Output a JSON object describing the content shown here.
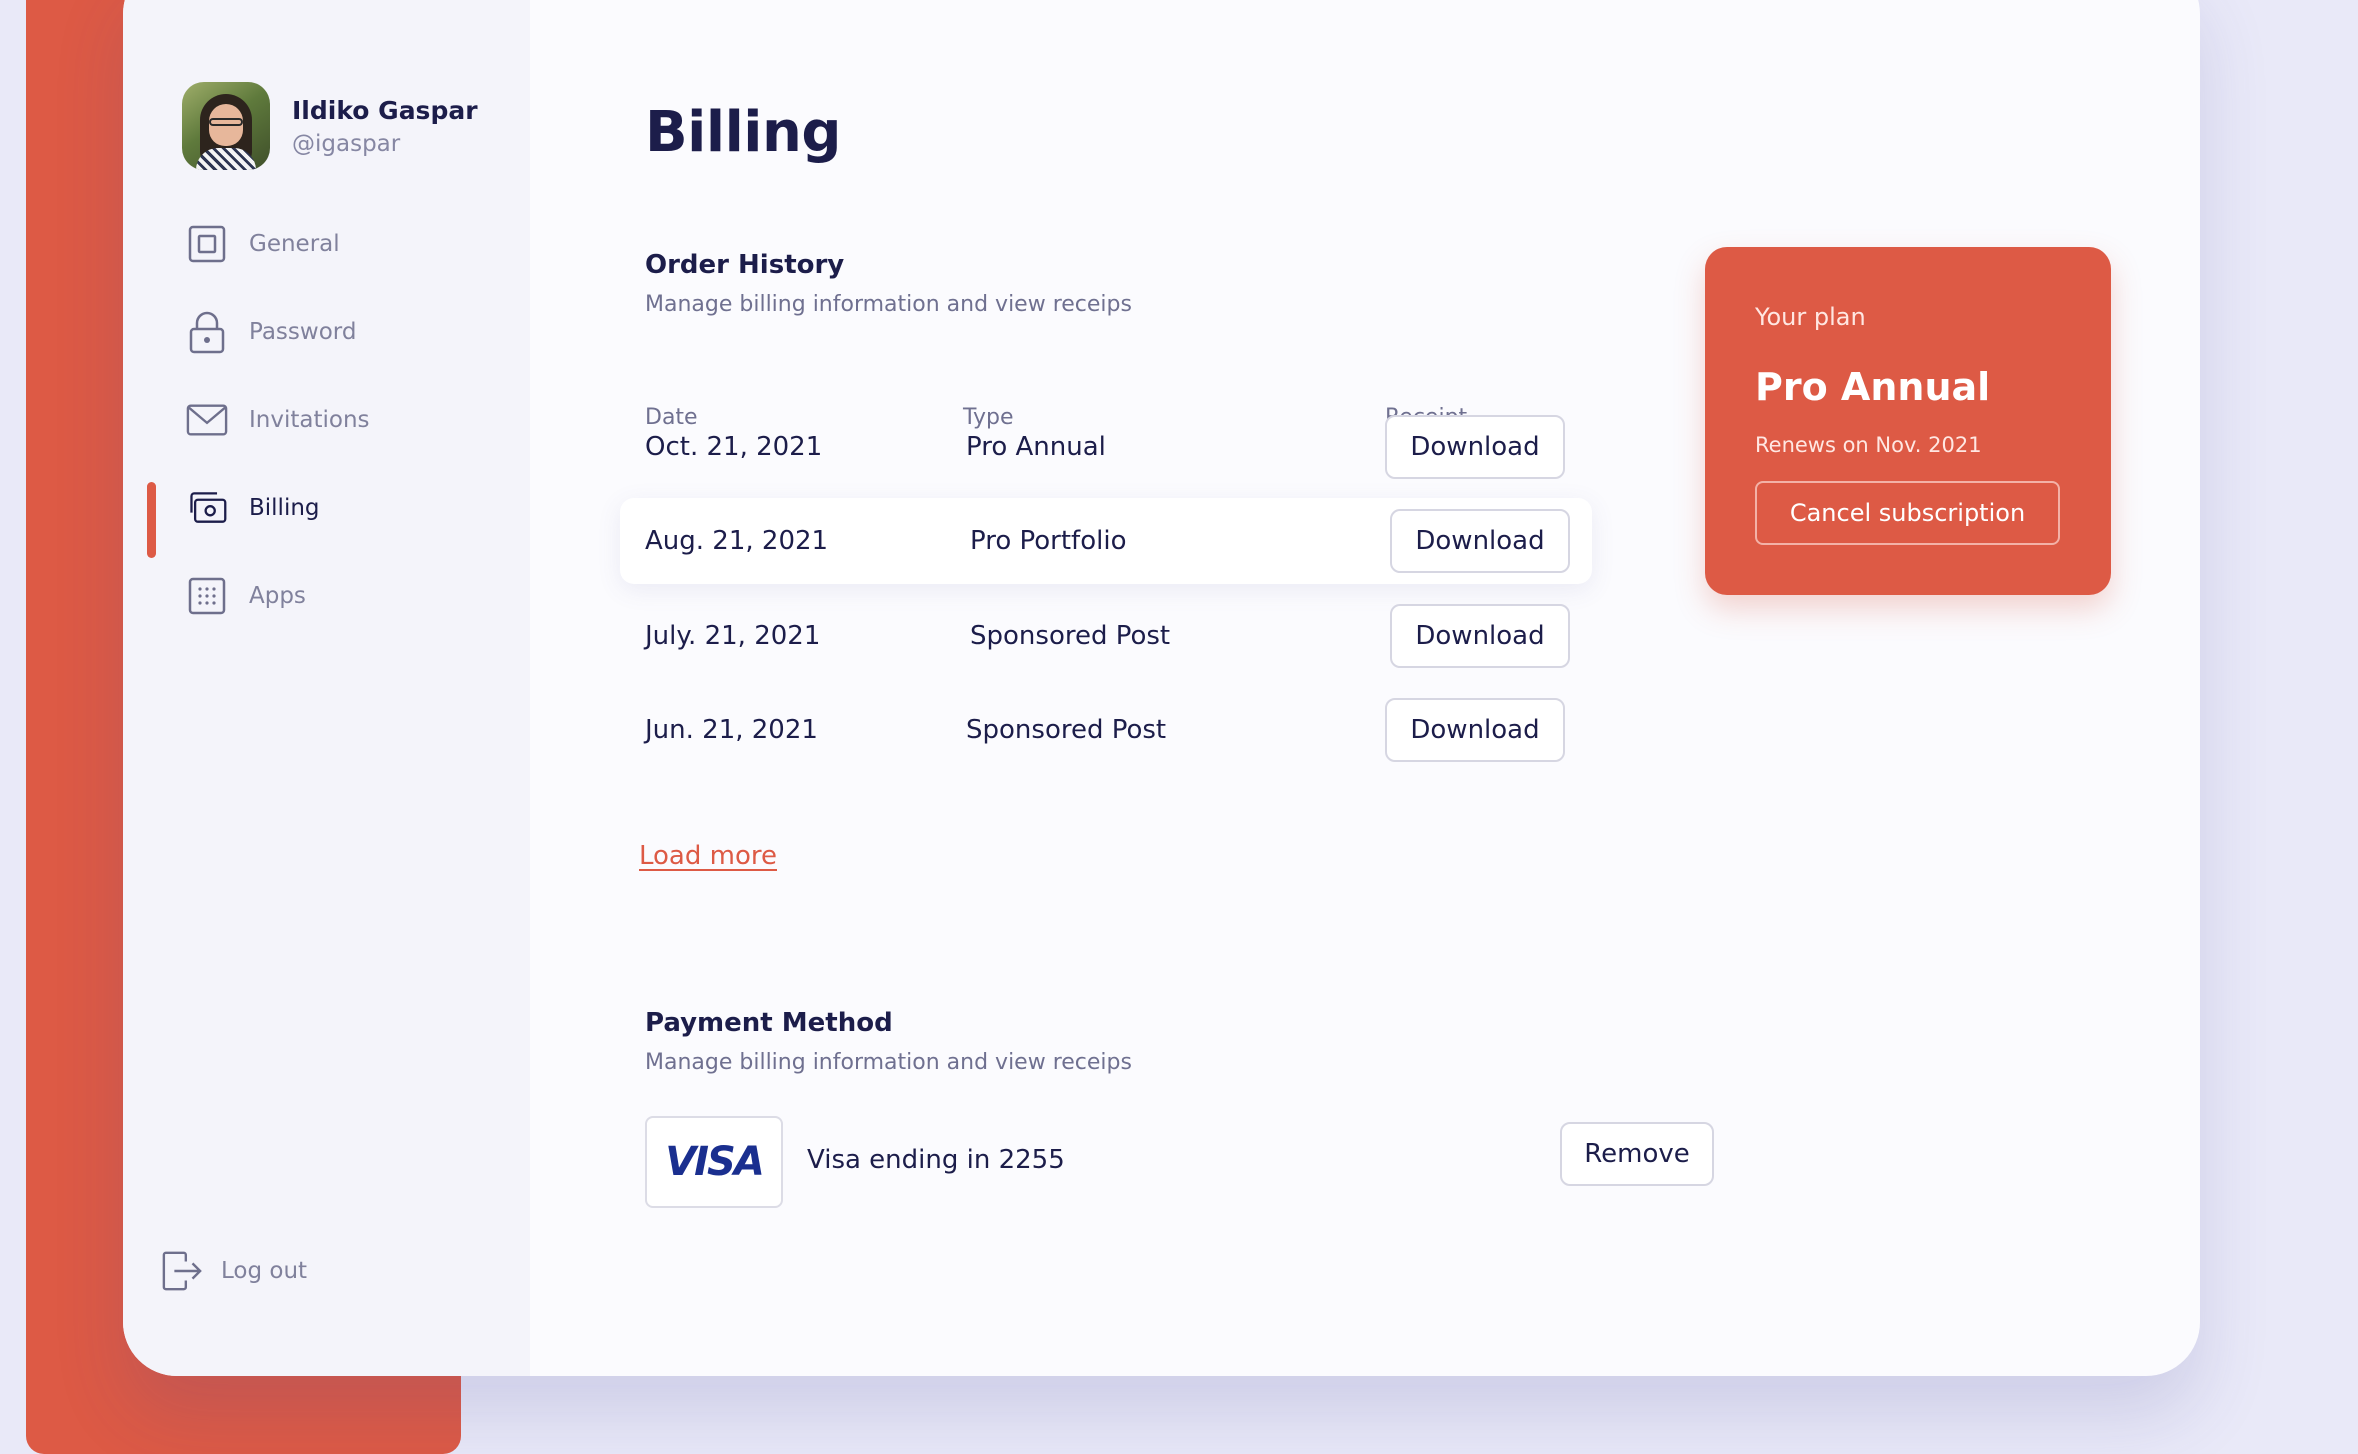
{
  "user": {
    "name": "Ildiko Gaspar",
    "handle": "@igaspar"
  },
  "nav": {
    "items": [
      {
        "label": "General"
      },
      {
        "label": "Password"
      },
      {
        "label": "Invitations"
      },
      {
        "label": "Billing"
      },
      {
        "label": "Apps"
      }
    ],
    "active": "Billing",
    "logout": "Log out"
  },
  "page": {
    "title": "Billing"
  },
  "order_history": {
    "title": "Order History",
    "subtitle": "Manage billing information and view receips",
    "columns": {
      "date": "Date",
      "type": "Type",
      "receipt": "Receipt"
    },
    "rows": [
      {
        "date": "Oct. 21, 2021",
        "type": "Pro Annual",
        "action": "Download"
      },
      {
        "date": "Aug. 21, 2021",
        "type": "Pro Portfolio",
        "action": "Download"
      },
      {
        "date": "July. 21, 2021",
        "type": "Sponsored Post",
        "action": "Download"
      },
      {
        "date": "Jun. 21, 2021",
        "type": "Sponsored Post",
        "action": "Download"
      }
    ],
    "load_more": "Load more"
  },
  "payment": {
    "title": "Payment Method",
    "subtitle": "Manage billing information and view receips",
    "card_brand": "VISA",
    "card_text": "Visa ending in 2255",
    "remove": "Remove"
  },
  "plan": {
    "label": "Your plan",
    "name": "Pro Annual",
    "renews": "Renews on  Nov. 2021",
    "cancel": "Cancel subscription"
  },
  "colors": {
    "accent": "#dd5a45",
    "text": "#1c1d4a",
    "muted": "#6f7090",
    "background": "#e9e9f8"
  },
  "icons": [
    "general-icon",
    "lock-icon",
    "mail-icon",
    "billing-icon",
    "apps-icon",
    "logout-icon"
  ]
}
